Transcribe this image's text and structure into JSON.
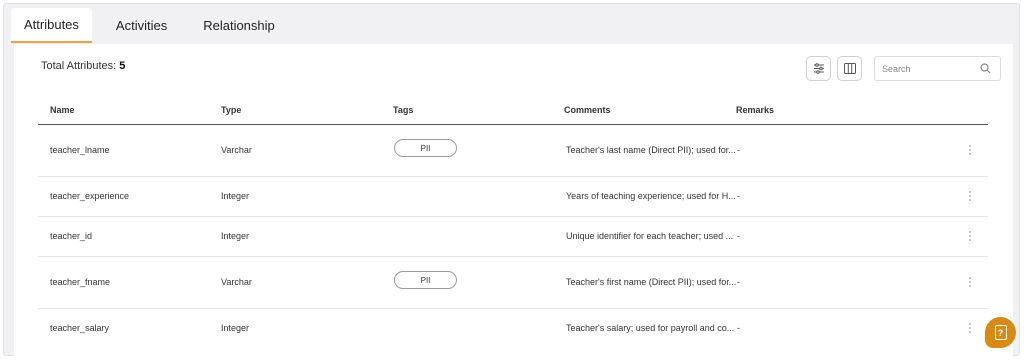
{
  "tabs": [
    {
      "label": "Attributes",
      "active": true
    },
    {
      "label": "Activities",
      "active": false
    },
    {
      "label": "Relationship",
      "active": false
    }
  ],
  "summary": {
    "label": "Total Attributes:",
    "count": "5"
  },
  "toolbar": {
    "filter_icon": "sliders-icon",
    "columns_icon": "columns-icon"
  },
  "search": {
    "placeholder": "Search",
    "value": ""
  },
  "columns": [
    "Name",
    "Type",
    "Tags",
    "Comments",
    "Remarks"
  ],
  "rows": [
    {
      "name": "teacher_lname",
      "type": "Varchar",
      "tag": "PII",
      "comment": "Teacher's last name (Direct PII); used for...",
      "remarks": "-"
    },
    {
      "name": "teacher_experience",
      "type": "Integer",
      "tag": "",
      "comment": "Years of teaching experience; used for H...",
      "remarks": "-"
    },
    {
      "name": "teacher_id",
      "type": "Integer",
      "tag": "",
      "comment": "Unique identifier for each teacher; used ...",
      "remarks": "-"
    },
    {
      "name": "teacher_fname",
      "type": "Varchar",
      "tag": "PII",
      "comment": "Teacher's first name (Direct PII); used for...",
      "remarks": "-"
    },
    {
      "name": "teacher_salary",
      "type": "Integer",
      "tag": "",
      "comment": "Teacher's salary; used for payroll and co...",
      "remarks": "-"
    }
  ],
  "colors": {
    "accent": "#f0a23a",
    "help_button": "#d88a14"
  }
}
